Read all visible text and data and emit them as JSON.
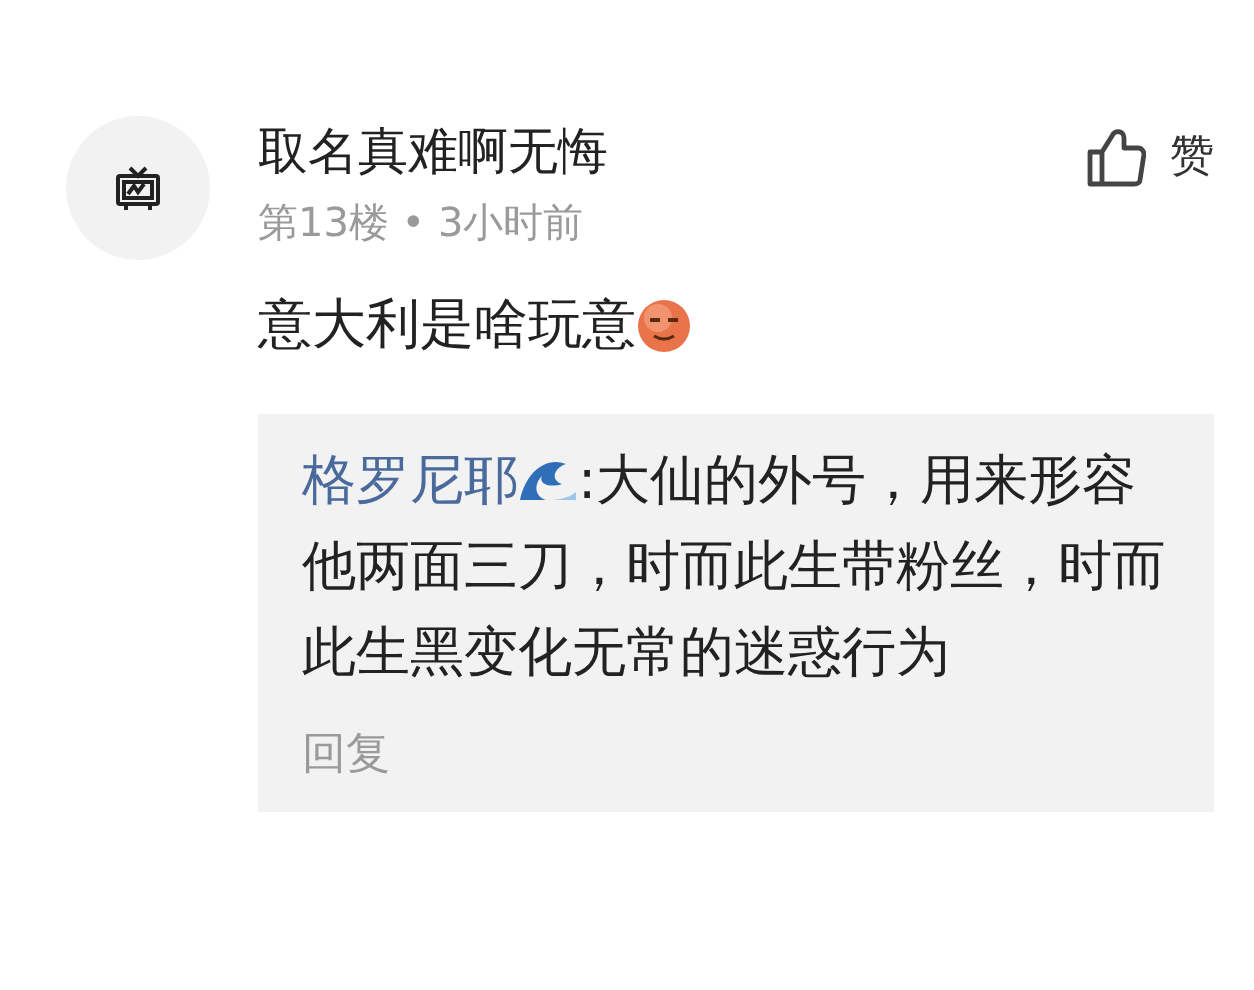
{
  "comment": {
    "author": "取名真难啊无悔",
    "meta": "第13楼 • 3小时前",
    "text": "意大利是啥玩意",
    "like_label": "赞"
  },
  "reply": {
    "author": "格罗尼耶",
    "text": ":大仙的外号，用来形容他两面三刀，时而此生带粉丝，时而此生黑变化无常的迷惑行为",
    "action": "回复"
  }
}
